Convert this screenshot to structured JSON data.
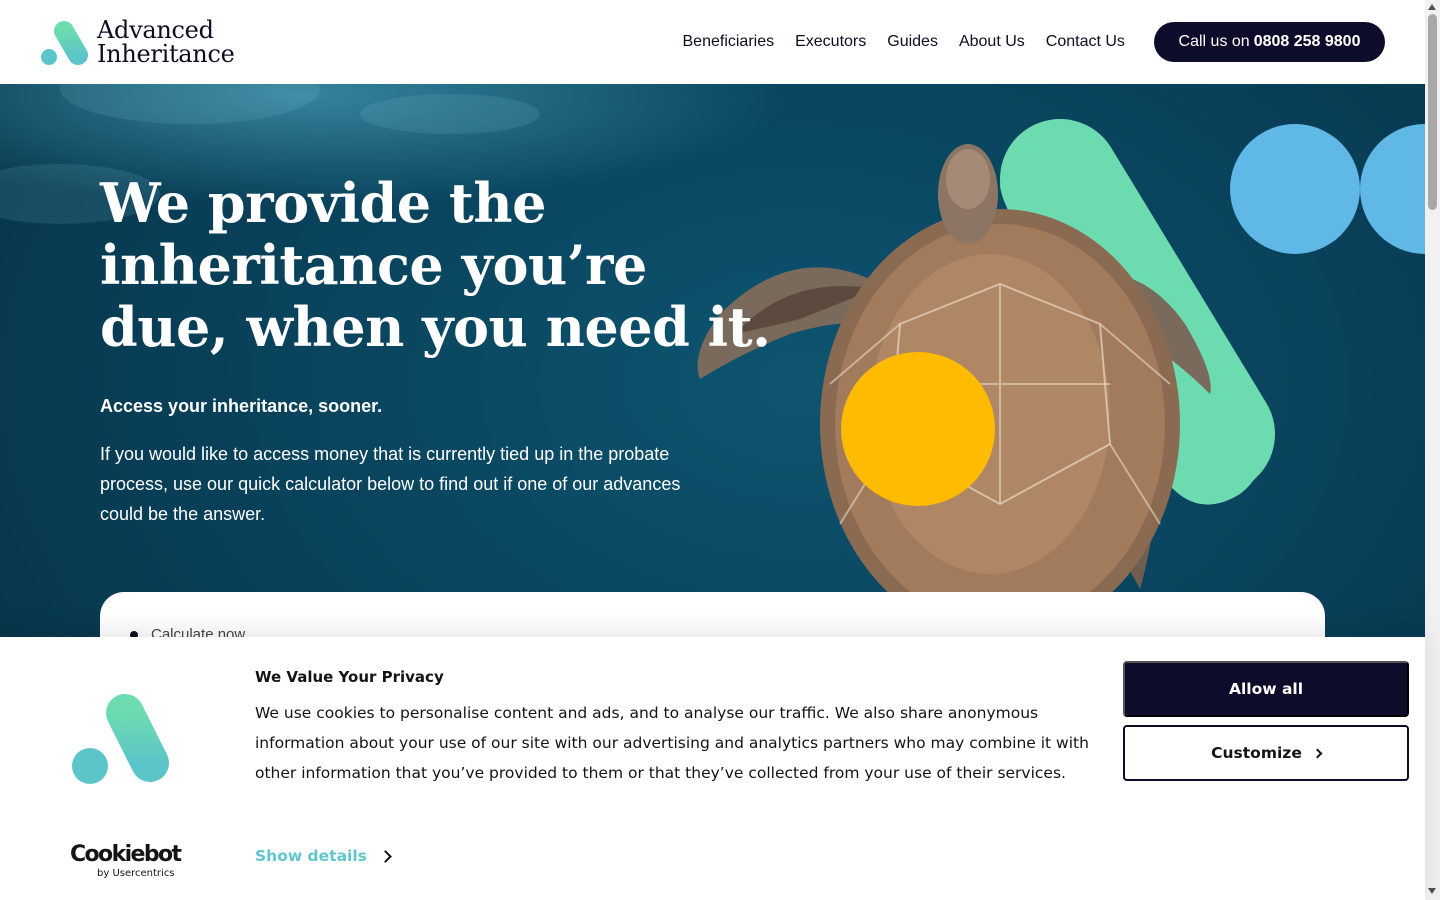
{
  "header": {
    "logo_line1": "Advanced",
    "logo_line2": "Inheritance",
    "nav": [
      "Beneficiaries",
      "Executors",
      "Guides",
      "About Us",
      "Contact Us"
    ],
    "call_prefix": "Call us on",
    "call_number": "0808 258 9800"
  },
  "hero": {
    "title": "We provide the inheritance you’re due, when you need it.",
    "subtitle": "Access your inheritance, sooner.",
    "body": "If you would like to access money that is currently tied up in the probate process, use our quick calculator below to find out if one of our advances could be the answer.",
    "calculator_item": "Calculate now"
  },
  "cookie_banner": {
    "title": "We Value Your Privacy",
    "text": "We use cookies to personalise content and ads, and to analyse our traffic. We also share anonymous information about your use of our site with our advertising and analytics partners who may combine it with other information that you’ve provided to them or that they’ve collected from your use of their services.",
    "show_details": "Show details",
    "allow_all": "Allow all",
    "customize": "Customize",
    "brand_word": "Cookiebot",
    "brand_by": "by Usercentrics"
  },
  "colors": {
    "navy": "#0d0d2b",
    "mint": "#6ddbb0",
    "sky": "#5fb8e6",
    "yellow": "#ffbb00",
    "teal_link": "#62c6cf"
  },
  "icons": [
    "logo-mark-icon",
    "turtle-icon",
    "chevron-right-icon"
  ]
}
